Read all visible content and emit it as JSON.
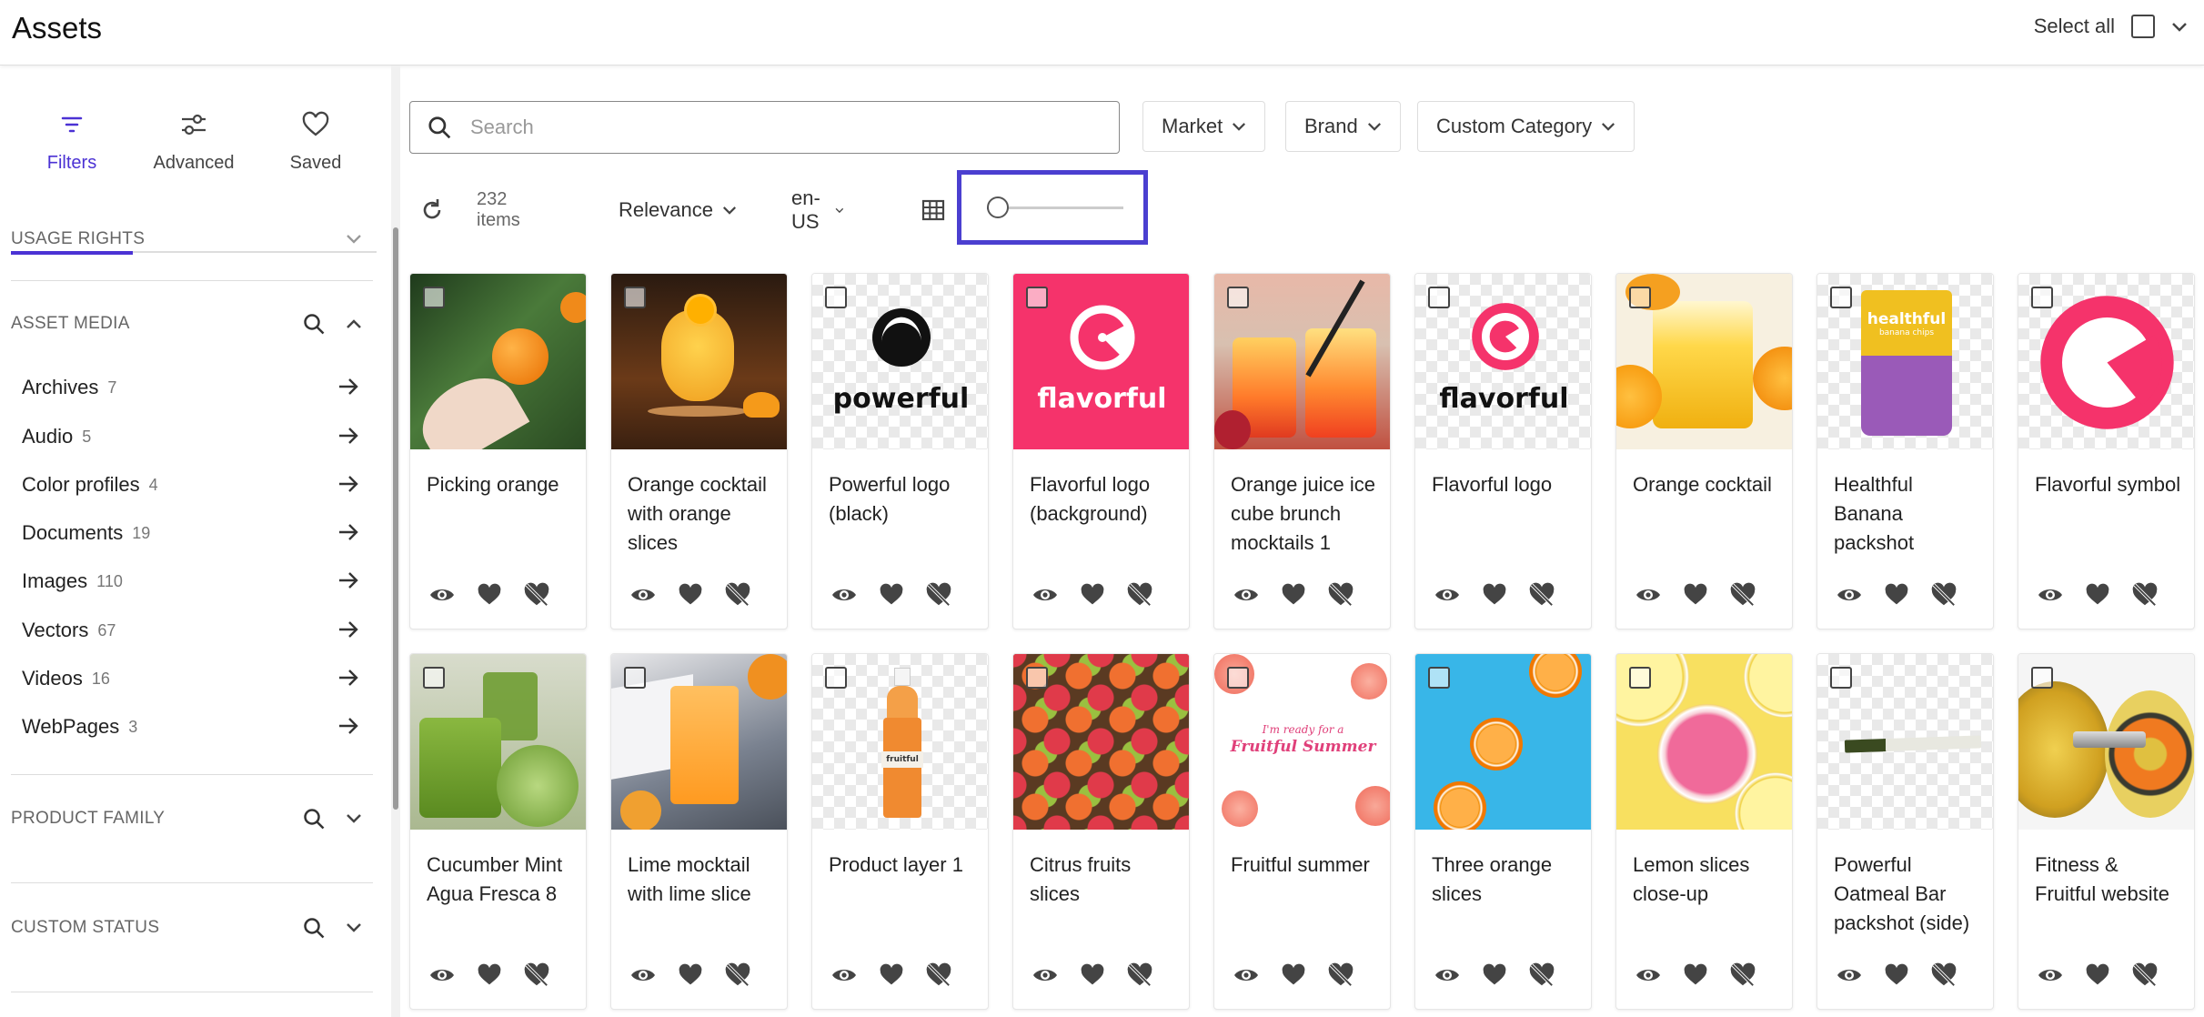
{
  "header": {
    "title": "Assets",
    "select_all_label": "Select all"
  },
  "sidebar": {
    "tabs": [
      {
        "label": "Filters",
        "icon": "filter-icon",
        "active": true
      },
      {
        "label": "Advanced",
        "icon": "sliders-icon",
        "active": false
      },
      {
        "label": "Saved",
        "icon": "heart-outline-icon",
        "active": false
      }
    ],
    "sections": {
      "usage_rights": "USAGE RIGHTS",
      "asset_media": "ASSET MEDIA",
      "product_family": "PRODUCT FAMILY",
      "custom_status": "CUSTOM STATUS"
    },
    "facets": [
      {
        "label": "Archives",
        "count": "7"
      },
      {
        "label": "Audio",
        "count": "5"
      },
      {
        "label": "Color profiles",
        "count": "4"
      },
      {
        "label": "Documents",
        "count": "19"
      },
      {
        "label": "Images",
        "count": "110"
      },
      {
        "label": "Vectors",
        "count": "67"
      },
      {
        "label": "Videos",
        "count": "16"
      },
      {
        "label": "WebPages",
        "count": "3"
      }
    ]
  },
  "search": {
    "placeholder": "Search"
  },
  "filters": {
    "market": "Market",
    "brand": "Brand",
    "custom_category": "Custom Category"
  },
  "toolbar": {
    "item_count": "232 items",
    "sort": "Relevance",
    "locale": "en-US",
    "zoom_level": 0.05
  },
  "accent_color": "#4b32d4",
  "assets": [
    {
      "name": "Picking orange"
    },
    {
      "name": "Orange cocktail with orange slices"
    },
    {
      "name": "Powerful logo (black)",
      "logo_text": "powerful"
    },
    {
      "name": "Flavorful logo (background)",
      "logo_text": "flavorful"
    },
    {
      "name": "Orange juice ice cube brunch mocktails 1"
    },
    {
      "name": "Flavorful logo",
      "logo_text": "flavorful"
    },
    {
      "name": "Orange cocktail"
    },
    {
      "name": "Healthful Banana packshot",
      "pack_text": "healthful",
      "pack_sub": "banana chips"
    },
    {
      "name": "Flavorful symbol"
    },
    {
      "name": "Cucumber Mint Agua Fresca 8"
    },
    {
      "name": "Lime mocktail with lime slice"
    },
    {
      "name": "Product layer 1",
      "bottle_text": "fruitful"
    },
    {
      "name": "Citrus fruits slices"
    },
    {
      "name": "Fruitful summer",
      "script_text_1": "I'm ready for a",
      "script_text_2": "Fruitful Summer"
    },
    {
      "name": "Three orange slices"
    },
    {
      "name": "Lemon slices close-up"
    },
    {
      "name": "Powerful Oatmeal Bar packshot (side)"
    },
    {
      "name": "Fitness & Fruitful website"
    }
  ]
}
